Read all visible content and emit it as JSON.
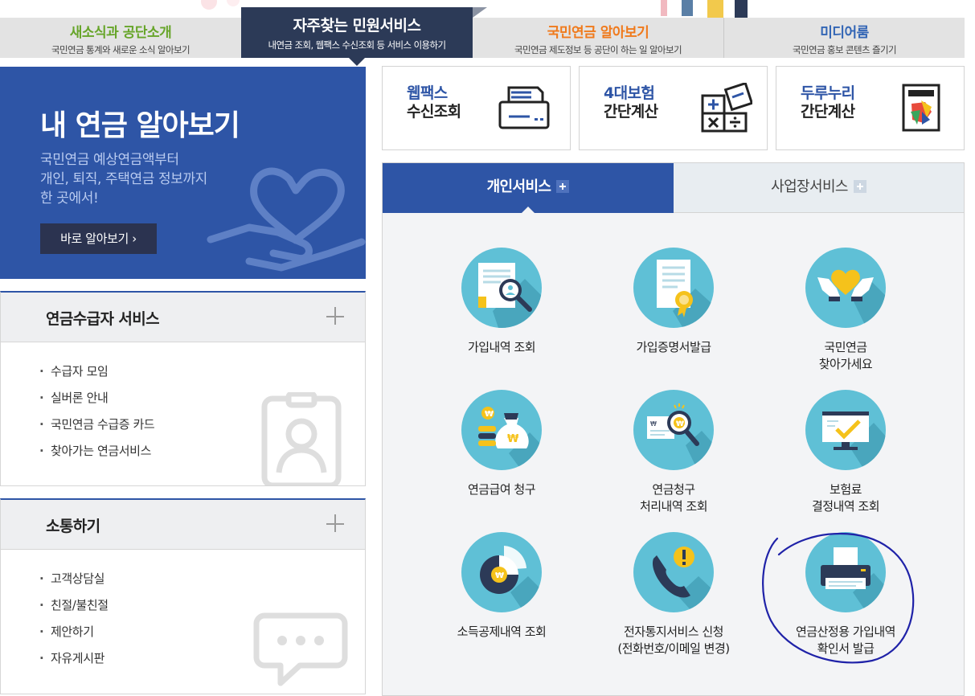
{
  "top_nav": [
    {
      "title": "새소식과 공단소개",
      "subtitle": "국민연금 통계와 새로운 소식 알아보기",
      "color": "#67a52a",
      "active": false
    },
    {
      "title": "자주찾는 민원서비스",
      "subtitle": "내연금 조회, 웹팩스 수신조회 등 서비스 이용하기",
      "color": "#ffffff",
      "active": true
    },
    {
      "title": "국민연금 알아보기",
      "subtitle": "국민연금 제도정보 등 공단이 하는 일 알아보기",
      "color": "#f07a1c",
      "active": false
    },
    {
      "title": "미디어룸",
      "subtitle": "국민연금 홍보 콘텐츠 즐기기",
      "color": "#3366b5",
      "active": false
    }
  ],
  "hero": {
    "title": "내 연금 알아보기",
    "desc": [
      "국민연금 예상연금액부터",
      "개인, 퇴직, 주택연금 정보까지",
      "한 곳에서!"
    ],
    "button_label": "바로 알아보기 ›"
  },
  "pensioner_services": {
    "title": "연금수급자 서비스",
    "items": [
      "수급자 모임",
      "실버론 안내",
      "국민연금 수급증 카드",
      "찾아가는 연금서비스"
    ]
  },
  "communication": {
    "title": "소통하기",
    "items": [
      "고객상담실",
      "친절/불친절",
      "제안하기",
      "자유게시판"
    ]
  },
  "quick_links": [
    {
      "line1": "웹팩스",
      "line2": "수신조회",
      "icon": "fax-icon"
    },
    {
      "line1": "4대보험",
      "line2": "간단계산",
      "icon": "calculator-icon"
    },
    {
      "line1": "두루누리",
      "line2": "간단계산",
      "icon": "durunuri-calculator-icon"
    }
  ],
  "service_tabs": {
    "personal": "개인서비스",
    "business": "사업장서비스"
  },
  "services": [
    {
      "lines": [
        "가입내역 조회"
      ],
      "icon": "document-search-icon"
    },
    {
      "lines": [
        "가입증명서발급"
      ],
      "icon": "certificate-icon"
    },
    {
      "lines": [
        "국민연금",
        "찾아가세요"
      ],
      "icon": "heart-hands-icon"
    },
    {
      "lines": [
        "연금급여 청구"
      ],
      "icon": "money-bag-icon"
    },
    {
      "lines": [
        "연금청구",
        "처리내역 조회"
      ],
      "icon": "claim-search-icon"
    },
    {
      "lines": [
        "보험료",
        "결정내역 조회"
      ],
      "icon": "monitor-check-icon"
    },
    {
      "lines": [
        "소득공제내역 조회"
      ],
      "icon": "pie-chart-icon"
    },
    {
      "lines": [
        "전자통지서비스 신청",
        "(전화번호/이메일 변경)"
      ],
      "icon": "phone-alert-icon"
    },
    {
      "lines": [
        "연금산정용 가입내역",
        "확인서 발급"
      ],
      "icon": "printer-icon"
    }
  ],
  "colors": {
    "primary": "#2e55a6",
    "navy": "#2c3a57",
    "icon_circle": "#5fc0d6",
    "accent_yellow": "#f5c21b",
    "annotation": "#1f22a8"
  }
}
